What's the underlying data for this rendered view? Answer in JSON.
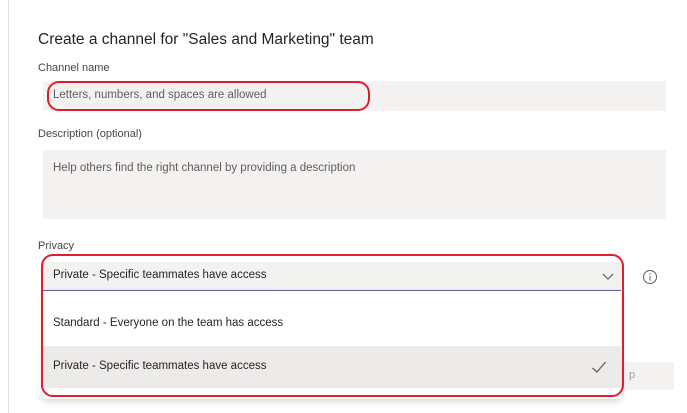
{
  "dialog": {
    "title": "Create a channel for \"Sales and Marketing\" team",
    "channel_name": {
      "label": "Channel name",
      "placeholder": "Letters, numbers, and spaces are allowed"
    },
    "description": {
      "label": "Description (optional)",
      "placeholder": "Help others find the right channel by providing a description"
    },
    "privacy": {
      "label": "Privacy",
      "selected": "Private - Specific teammates have access",
      "options": [
        "Standard - Everyone on the team has access",
        "Private - Specific teammates have access"
      ],
      "icon": "chevron-down-icon",
      "info_icon": "info-icon"
    },
    "partial_button_text": "p"
  },
  "colors": {
    "field_bg": "#f3f2f1",
    "accent": "#6264a7",
    "highlight": "#e01e2f",
    "selected_option_bg": "#edebe9"
  }
}
